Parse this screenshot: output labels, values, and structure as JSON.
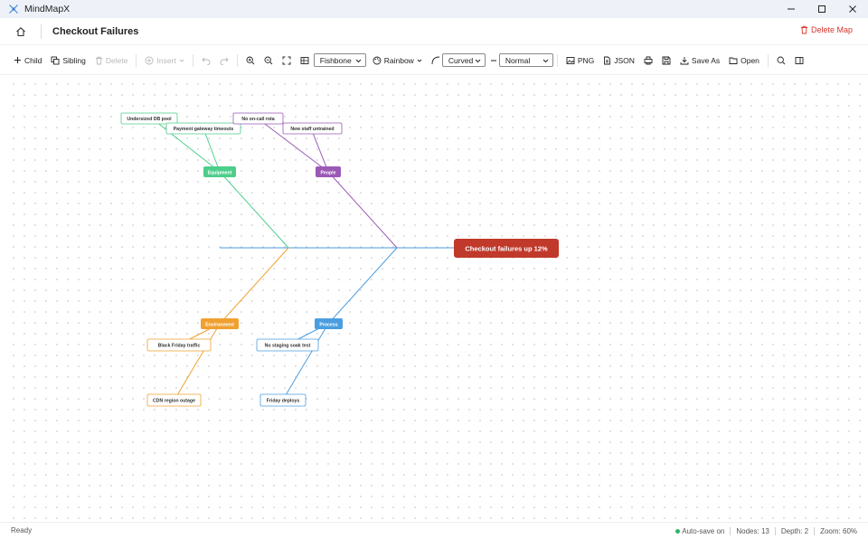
{
  "app": {
    "title": "MindMapX",
    "icon": "mindmap-logo-icon"
  },
  "window_controls": [
    "minimize-icon",
    "maximize-icon",
    "close-icon"
  ],
  "header": {
    "title": "Checkout Failures",
    "delete_label": "Delete Map"
  },
  "toolbar": {
    "child_label": "Child",
    "sibling_label": "Sibling",
    "delete_label": "Delete",
    "insert_label": "Insert",
    "layout_value": "Fishbone",
    "theme_label": "Rainbow",
    "line_style_value": "Curved",
    "line_width_value": "Normal",
    "png_label": "PNG",
    "json_label": "JSON",
    "save_as_label": "Save As",
    "open_label": "Open"
  },
  "mindmap": {
    "root": {
      "label": "Checkout failures up 12%",
      "color": "#c0392b"
    },
    "categories": [
      {
        "label": "Equipment",
        "color": "#4cce8b",
        "causes": [
          "Undersized DB pool",
          "Payment gateway timeouts"
        ]
      },
      {
        "label": "People",
        "color": "#9b59b6",
        "causes": [
          "No on-call rota",
          "New staff untrained"
        ]
      },
      {
        "label": "Environment",
        "color": "#f0a030",
        "causes": [
          "Black Friday traffic",
          "CDN region outage"
        ]
      },
      {
        "label": "Process",
        "color": "#4a9ee0",
        "causes": [
          "No staging soak test",
          "Friday deploys"
        ]
      }
    ]
  },
  "status": {
    "left": "Ready",
    "autosave": "Auto-save on",
    "nodes": "Nodes: 13",
    "depth": "Depth: 2",
    "zoom": "Zoom: 60%"
  }
}
